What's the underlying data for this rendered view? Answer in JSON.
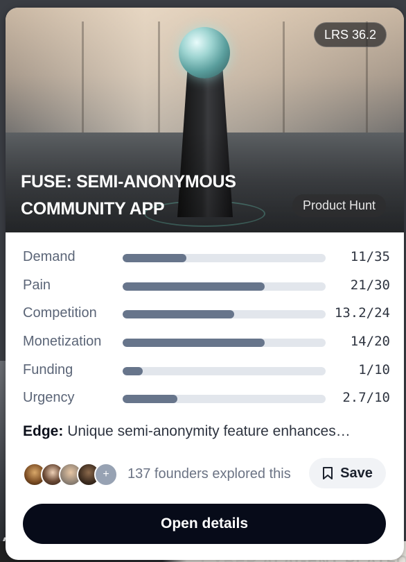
{
  "card": {
    "score_badge": "LRS 36.2",
    "title": "FUSE: SEMI-ANONYMOUS COMMUNITY APP",
    "source": "Product Hunt",
    "metrics": [
      {
        "label": "Demand",
        "value_text": "11/35",
        "score": 11,
        "max": 35
      },
      {
        "label": "Pain",
        "value_text": "21/30",
        "score": 21,
        "max": 30
      },
      {
        "label": "Competition",
        "value_text": "13.2/24",
        "score": 13.2,
        "max": 24
      },
      {
        "label": "Monetization",
        "value_text": "14/20",
        "score": 14,
        "max": 20
      },
      {
        "label": "Funding",
        "value_text": "1/10",
        "score": 1,
        "max": 10
      },
      {
        "label": "Urgency",
        "value_text": "2.7/10",
        "score": 2.7,
        "max": 10
      }
    ],
    "edge": {
      "key": "Edge:",
      "text": "Unique semi-anonymity feature enhances…"
    },
    "social": {
      "avatars": [
        "avatar-1",
        "avatar-2",
        "avatar-3",
        "avatar-4"
      ],
      "more_label": "+",
      "explored_text": "137 founders explored this"
    },
    "save_label": "Save",
    "open_label": "Open details"
  },
  "background": {
    "bottom_text": "CYBER AI AGENT PLATFO",
    "left_text": "A"
  },
  "colors": {
    "bar_fill": "#67758b",
    "bar_track": "#e2e6ec",
    "primary_button": "#070b19"
  }
}
